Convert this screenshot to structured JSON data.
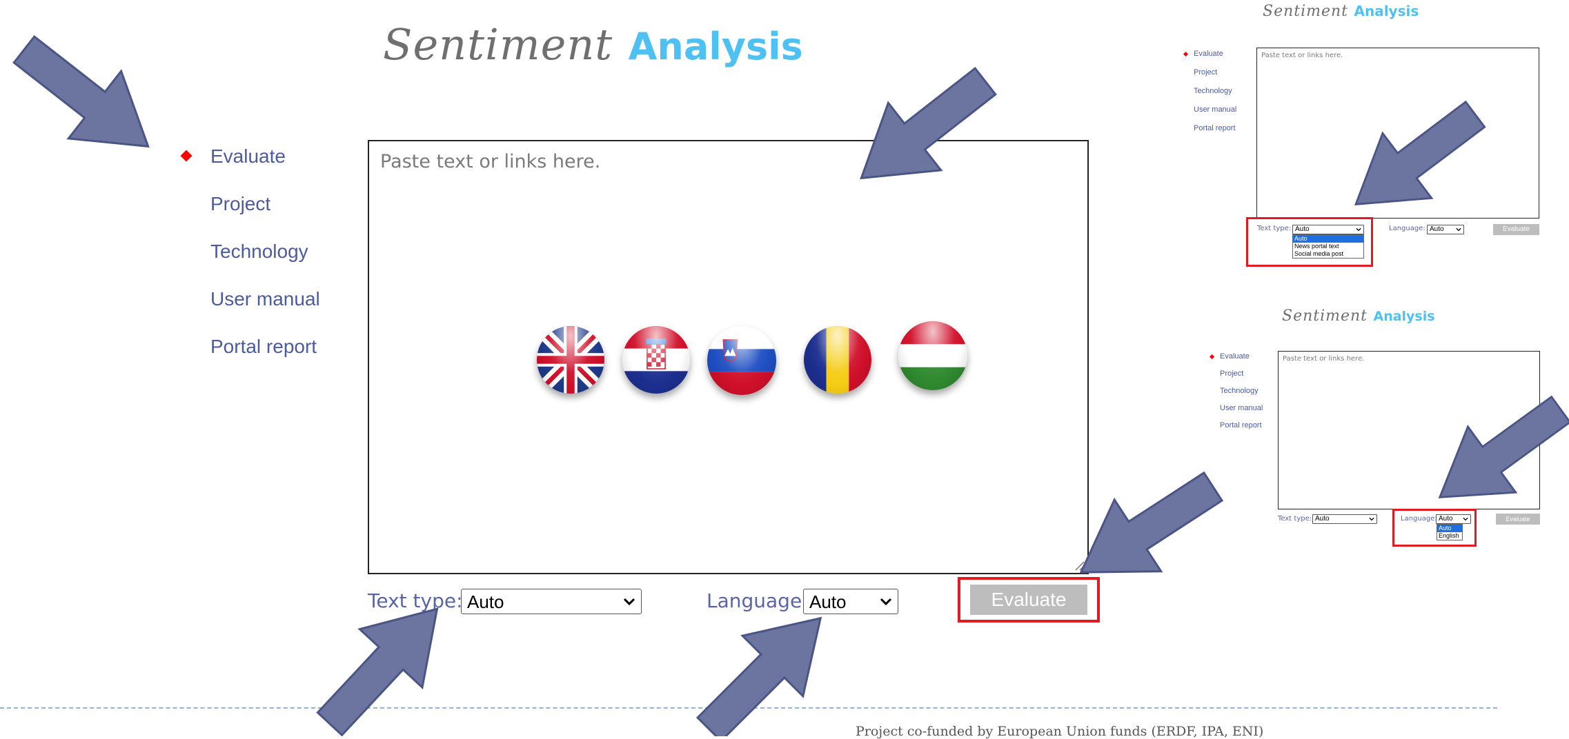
{
  "app": {
    "logo_script": "Sentiment",
    "logo_bold": "Analysis"
  },
  "nav": {
    "items": [
      {
        "label": "Evaluate",
        "active": true
      },
      {
        "label": "Project"
      },
      {
        "label": "Technology"
      },
      {
        "label": "User manual"
      },
      {
        "label": "Portal report"
      }
    ]
  },
  "main": {
    "textarea_placeholder": "Paste text or links here.",
    "text_type_label": "Text type:",
    "text_type_value": "Auto",
    "language_label": "Language:",
    "language_value": "Auto",
    "evaluate_button": "Evaluate",
    "flags": [
      "uk-flag-icon",
      "croatia-flag-icon",
      "slovenia-flag-icon",
      "romania-flag-icon",
      "hungary-flag-icon"
    ]
  },
  "thumb1": {
    "text_type_options": [
      "Auto",
      "News portal text",
      "Social media post"
    ]
  },
  "thumb2": {
    "language_options": [
      "Auto",
      "English"
    ]
  },
  "footer": {
    "text": "Project co-funded by European Union funds (ERDF, IPA, ENI)"
  },
  "colors": {
    "accent": "#4fc0f2",
    "nav": "#4c5aa0",
    "highlight": "#e21b23",
    "arrow": "#6b75a0"
  }
}
